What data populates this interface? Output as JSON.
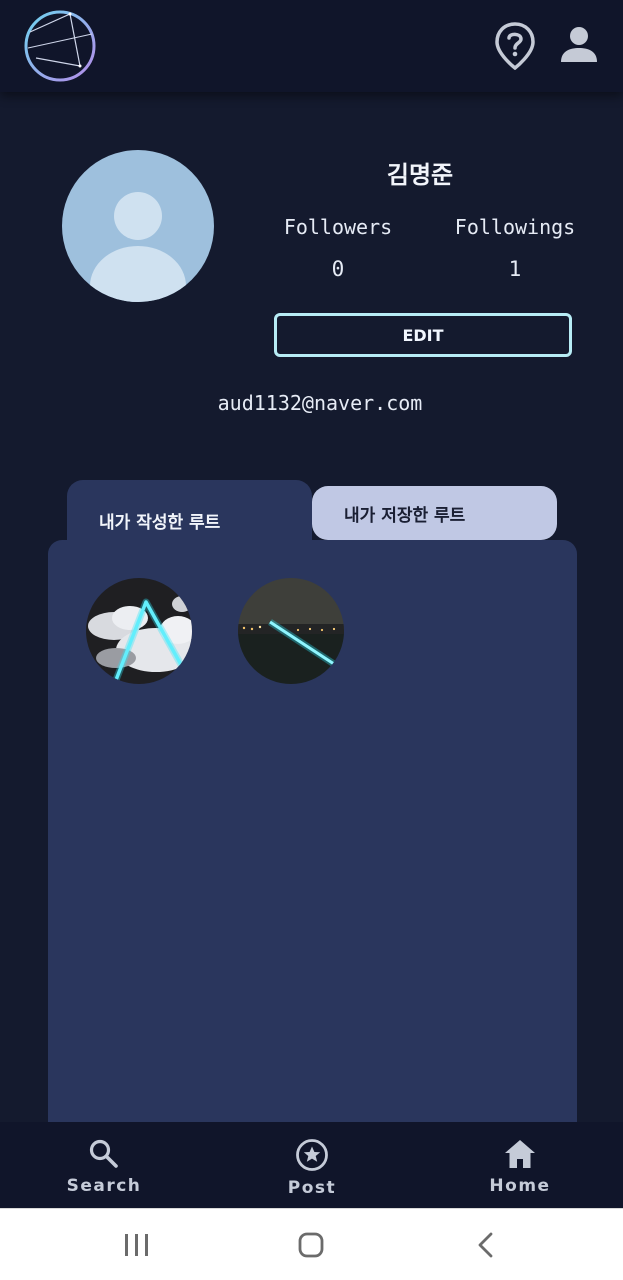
{
  "profile": {
    "name": "김명준",
    "followers_label": "Followers",
    "followers_count": "0",
    "followings_label": "Followings",
    "followings_count": "1",
    "edit_label": "EDIT",
    "email": "aud1132@naver.com"
  },
  "tabs": [
    {
      "label": "내가 작성한 루트",
      "active": true
    },
    {
      "label": "내가 저장한 루트",
      "active": false
    }
  ],
  "routes": [
    {
      "thumbnail": "cloud-sky-route"
    },
    {
      "thumbnail": "night-river-route"
    }
  ],
  "bottom_nav": [
    {
      "label": "Search",
      "icon": "search-icon"
    },
    {
      "label": "Post",
      "icon": "star-circle-icon"
    },
    {
      "label": "Home",
      "icon": "home-icon"
    }
  ],
  "system_nav": [
    "recent-apps-icon",
    "home-circle-icon",
    "back-icon"
  ],
  "colors": {
    "background": "#141a2e",
    "topbar": "#10152a",
    "panel": "#2a365d",
    "tab_inactive": "#c0c8e4",
    "accent": "#b7ecf5",
    "avatar": "#9ec0dd"
  }
}
